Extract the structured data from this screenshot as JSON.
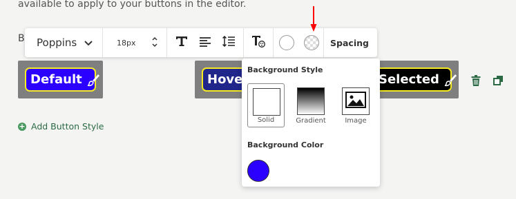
{
  "intro_text": "available to apply to your buttons in the editor.",
  "partial_label": "B",
  "button_styles": [
    {
      "label": "Default",
      "bg": "#2b00ff"
    },
    {
      "label": "Hover",
      "bg": "#20268a"
    },
    {
      "label": "Selected",
      "bg": "#000000"
    }
  ],
  "add_button_style": "Add Button Style",
  "toolbar": {
    "font": "Poppins",
    "font_size": "18px",
    "spacing_label": "Spacing"
  },
  "popover": {
    "style_title": "Background Style",
    "options": [
      {
        "label": "Solid",
        "selected": true
      },
      {
        "label": "Gradient",
        "selected": false
      },
      {
        "label": "Image",
        "selected": false
      }
    ],
    "color_title": "Background Color",
    "color": "#2b00ff"
  },
  "colors": {
    "accent_green": "#2b6a44",
    "card_gray": "#7f7f7f",
    "border_yellow": "#f6ec21",
    "annotation_red": "#ff0000"
  }
}
